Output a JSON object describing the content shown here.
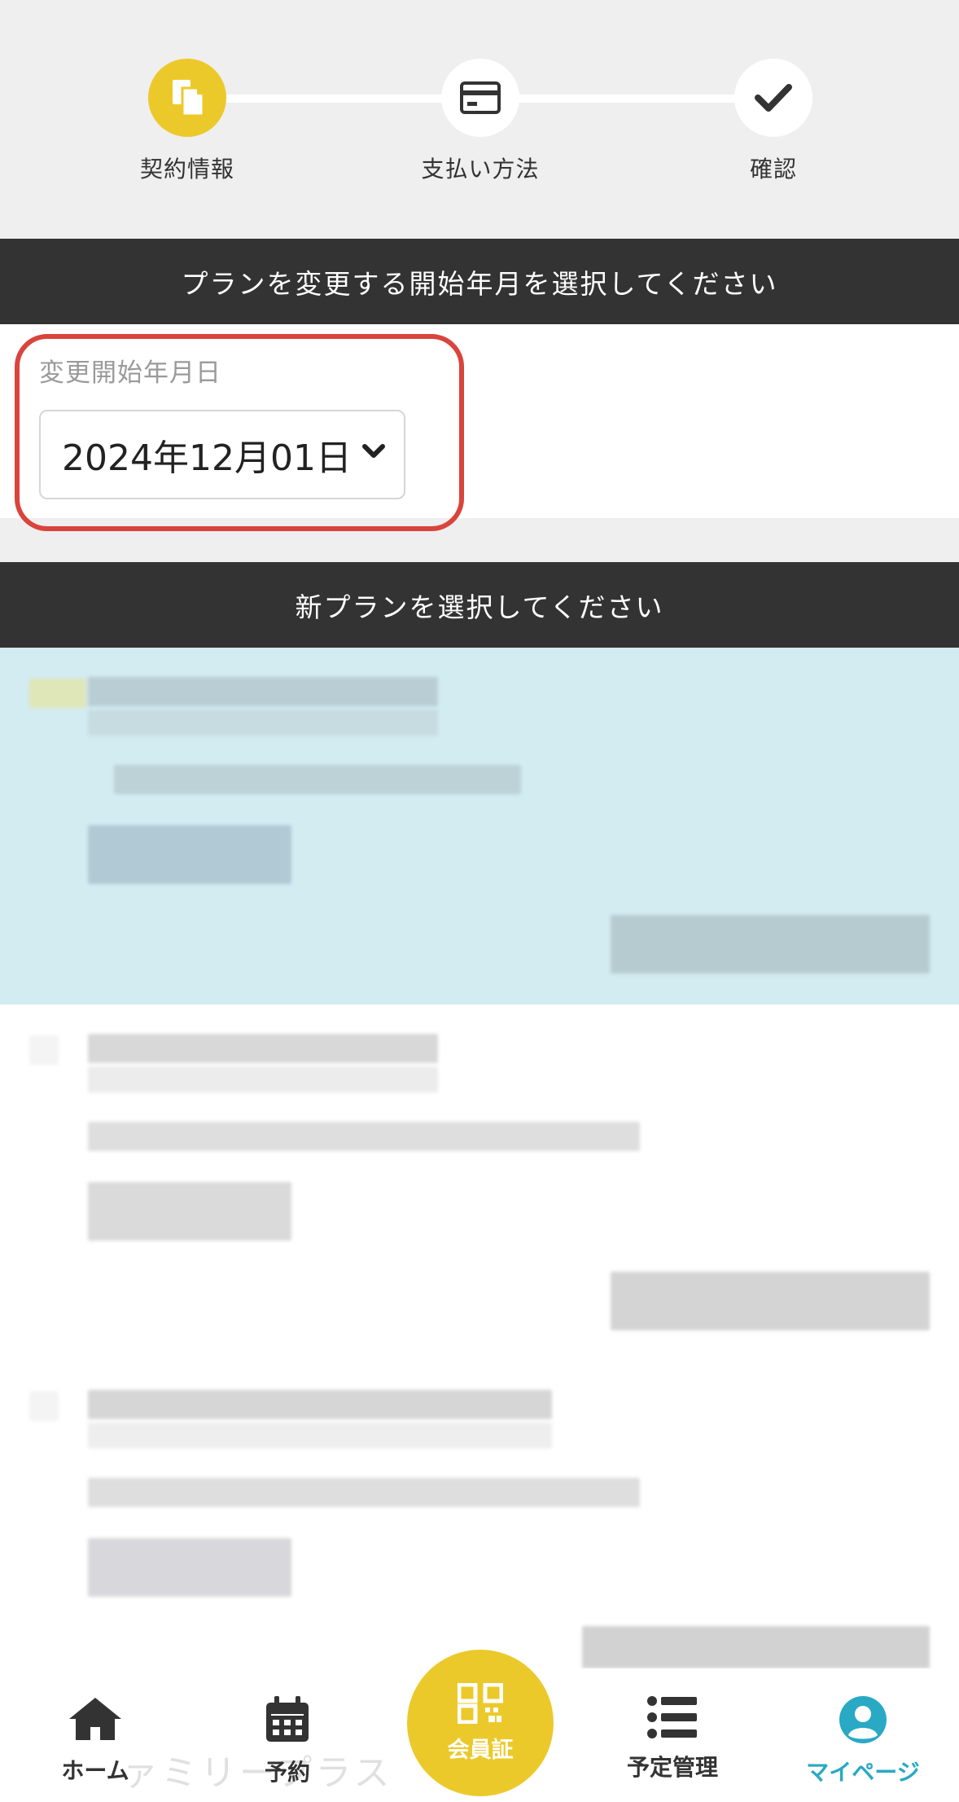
{
  "stepper": {
    "steps": [
      {
        "label": "契約情報",
        "icon": "document-copy-icon",
        "active": true
      },
      {
        "label": "支払い方法",
        "icon": "credit-card-icon",
        "active": false
      },
      {
        "label": "確認",
        "icon": "checkmark-icon",
        "active": false
      }
    ]
  },
  "start_date_section": {
    "header": "プランを変更する開始年月を選択してください",
    "field_label": "変更開始年月日",
    "selected_value": "2024年12月01日"
  },
  "plan_section": {
    "header": "新プランを選択してください"
  },
  "bottom_nav": {
    "items": [
      {
        "label": "ホーム",
        "icon": "home-icon"
      },
      {
        "label": "予約",
        "icon": "calendar-icon"
      },
      {
        "label": "会員証",
        "icon": "qr-code-icon"
      },
      {
        "label": "予定管理",
        "icon": "list-icon"
      },
      {
        "label": "マイページ",
        "icon": "user-circle-icon"
      }
    ],
    "current": "マイページ",
    "background_text": "ァミリープラス"
  },
  "colors": {
    "accent_yellow": "#ecc92a",
    "header_dark": "#333333",
    "highlight_red": "#d9443c",
    "selected_plan_bg": "#d3ecf1",
    "active_nav": "#29a9c4"
  }
}
